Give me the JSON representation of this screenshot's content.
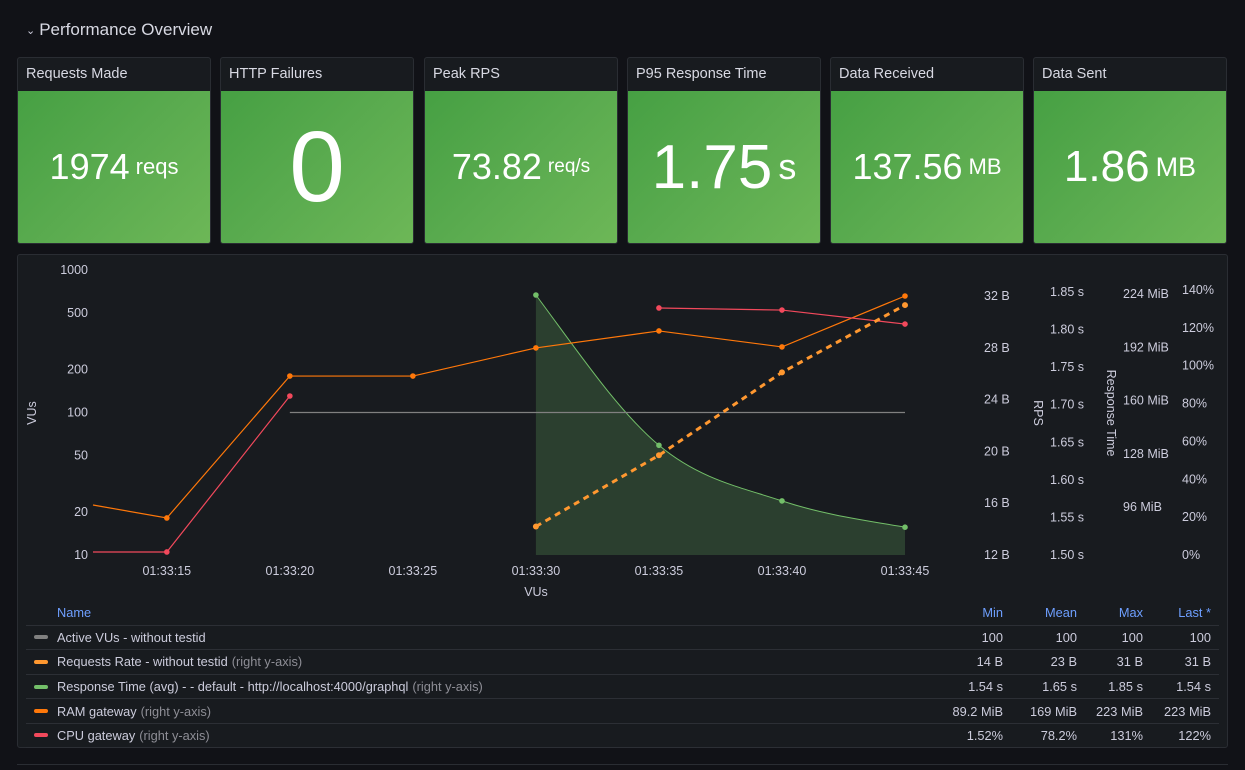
{
  "row": {
    "title": "Performance Overview",
    "chevron_icon": "chevron-down-icon"
  },
  "stats": [
    {
      "title": "Requests Made",
      "value": "1974",
      "unit": "reqs"
    },
    {
      "title": "HTTP Failures",
      "value": "0",
      "unit": ""
    },
    {
      "title": "Peak RPS",
      "value": "73.82",
      "unit": "req/s"
    },
    {
      "title": "P95 Response Time",
      "value": "1.75",
      "unit": "s"
    },
    {
      "title": "Data Received",
      "value": "137.56",
      "unit": "MB"
    },
    {
      "title": "Data Sent",
      "value": "1.86",
      "unit": "MB"
    }
  ],
  "colors": {
    "stat_green": "#56a64b",
    "vus": "#808080",
    "requests": "#ff9830",
    "response": "#73bf69",
    "ram": "#ff780a",
    "cpu": "#f2495c"
  },
  "chart_data": {
    "type": "line",
    "xlabel": "VUs",
    "x_ticks": [
      "01:33:15",
      "01:33:20",
      "01:33:25",
      "01:33:30",
      "01:33:35",
      "01:33:40",
      "01:33:45"
    ],
    "x_range_seconds": [
      12,
      45
    ],
    "axes": {
      "left": {
        "label": "VUs",
        "scale": "log",
        "range": [
          10,
          1000
        ],
        "ticks": [
          "1000",
          "500",
          "200",
          "100",
          "50",
          "20",
          "10"
        ],
        "tick_values": [
          1000,
          500,
          200,
          100,
          50,
          20,
          10
        ]
      },
      "right_bytes": {
        "label": "",
        "range": [
          12,
          32
        ],
        "ticks": [
          "32 B",
          "28 B",
          "24 B",
          "20 B",
          "16 B",
          "12 B"
        ],
        "tick_values": [
          32,
          28,
          24,
          20,
          16,
          12
        ]
      },
      "right_seconds": {
        "label": "RPS",
        "range": [
          1.5,
          1.85
        ],
        "ticks": [
          "1.85 s",
          "1.80 s",
          "1.75 s",
          "1.70 s",
          "1.65 s",
          "1.60 s",
          "1.55 s",
          "1.50 s"
        ],
        "tick_values": [
          1.85,
          1.8,
          1.75,
          1.7,
          1.65,
          1.6,
          1.55,
          1.5
        ]
      },
      "right_mib": {
        "label": "Response Time",
        "range": [
          67.2,
          238
        ],
        "ticks": [
          "224 MiB",
          "192 MiB",
          "160 MiB",
          "128 MiB",
          "96 MiB"
        ],
        "tick_values": [
          224,
          192,
          160,
          128,
          96
        ]
      },
      "right_percent": {
        "label": "",
        "range": [
          0,
          140
        ],
        "ticks": [
          "140%",
          "120%",
          "100%",
          "80%",
          "60%",
          "40%",
          "20%",
          "0%"
        ],
        "tick_values": [
          140,
          120,
          100,
          80,
          60,
          40,
          20,
          0
        ]
      }
    },
    "series": [
      {
        "name": "Active VUs - without testid",
        "axis": "left",
        "style": "solid",
        "points": false,
        "x": [
          20,
          45
        ],
        "values": [
          100,
          100
        ]
      },
      {
        "name": "Requests Rate - without testid",
        "axis": "right_bytes",
        "style": "dashed",
        "x": [
          30,
          35,
          40,
          45
        ],
        "values": [
          14.2,
          19.7,
          26.1,
          31.3
        ]
      },
      {
        "name": "Response Time (avg) - - default - http://localhost:4000/graphql",
        "axis": "right_seconds",
        "style": "smooth-area",
        "x": [
          30,
          35,
          40,
          45
        ],
        "values": [
          1.846,
          1.646,
          1.572,
          1.537
        ]
      },
      {
        "name": "RAM gateway",
        "axis": "right_mib",
        "style": "solid",
        "x": [
          12,
          15,
          20,
          25,
          30,
          35,
          40,
          45
        ],
        "values": [
          97.2,
          89.4,
          174.7,
          174.7,
          191.6,
          201.8,
          192.2,
          222.8
        ]
      },
      {
        "name": "CPU gateway",
        "axis": "right_percent",
        "style": "solid",
        "x": [
          12,
          15,
          20,
          35,
          40,
          45
        ],
        "values": [
          1.6,
          1.6,
          84,
          130.5,
          129.4,
          122
        ],
        "gap_after_index": 2
      }
    ]
  },
  "legend": {
    "headers": {
      "name": "Name",
      "min": "Min",
      "mean": "Mean",
      "max": "Max",
      "last": "Last *"
    },
    "rows": [
      {
        "name": "Active VUs - without testid",
        "hint": "",
        "color": "#808080",
        "min": "100",
        "mean": "100",
        "max": "100",
        "last": "100"
      },
      {
        "name": "Requests Rate - without testid",
        "hint": "(right y-axis)",
        "color": "#ff9830",
        "min": "14 B",
        "mean": "23 B",
        "max": "31 B",
        "last": "31 B"
      },
      {
        "name": "Response Time (avg) - - default - http://localhost:4000/graphql",
        "hint": "(right y-axis)",
        "color": "#73bf69",
        "min": "1.54 s",
        "mean": "1.65 s",
        "max": "1.85 s",
        "last": "1.54 s"
      },
      {
        "name": "RAM gateway",
        "hint": "(right y-axis)",
        "color": "#ff780a",
        "min": "89.2 MiB",
        "mean": "169 MiB",
        "max": "223 MiB",
        "last": "223 MiB"
      },
      {
        "name": "CPU gateway",
        "hint": "(right y-axis)",
        "color": "#f2495c",
        "min": "1.52%",
        "mean": "78.2%",
        "max": "131%",
        "last": "122%"
      }
    ]
  }
}
